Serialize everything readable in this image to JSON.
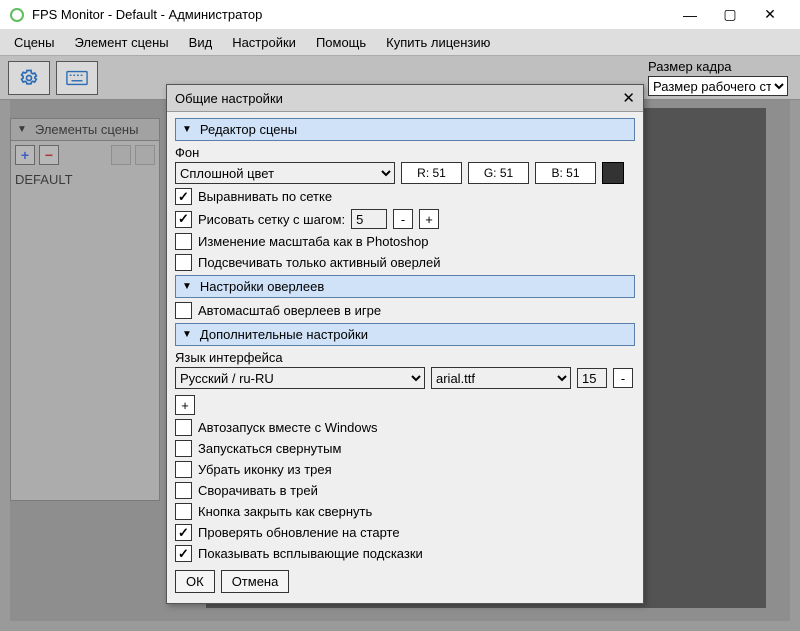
{
  "title": "FPS Monitor - Default - Администратор",
  "menu": [
    "Сцены",
    "Элемент сцены",
    "Вид",
    "Настройки",
    "Помощь",
    "Купить лицензию"
  ],
  "frameSize": {
    "label": "Размер кадра",
    "value": "Размер рабочего ст"
  },
  "sidebar": {
    "header": "Элементы сцены",
    "item": "DEFAULT"
  },
  "dialog": {
    "title": "Общие настройки",
    "sec1": "Редактор сцены",
    "bgLabel": "Фон",
    "bgMode": "Сплошной цвет",
    "r": "R: 51",
    "g": "G: 51",
    "b": "B: 51",
    "alignGrid": "Выравнивать по сетке",
    "drawGrid": "Рисовать сетку с шагом:",
    "step": "5",
    "zoomPS": "Изменение масштаба как в Photoshop",
    "hlActive": "Подсвечивать только активный оверлей",
    "sec2": "Настройки оверлеев",
    "autoscale": "Автомасштаб оверлеев в игре",
    "sec3": "Дополнительные настройки",
    "langLabel": "Язык интерфейса",
    "lang": "Русский / ru-RU",
    "font": "arial.ttf",
    "fsize": "15",
    "autorun": "Автозапуск вместе с Windows",
    "minStart": "Запускаться свернутым",
    "noTray": "Убрать иконку из трея",
    "toTray": "Сворачивать в трей",
    "closeMin": "Кнопка закрыть как свернуть",
    "checkUpd": "Проверять обновление на старте",
    "tooltips": "Показывать всплывающие подсказки",
    "ok": "ОК",
    "cancel": "Отмена"
  }
}
